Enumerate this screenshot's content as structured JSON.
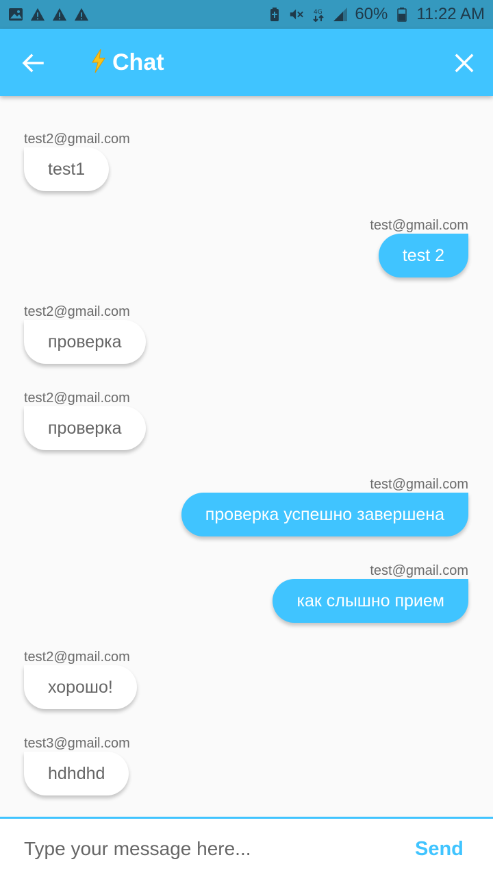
{
  "status_bar": {
    "battery": "60%",
    "time": "11:22 AM",
    "icons_left": [
      "image-icon",
      "warning-icon",
      "warning-icon",
      "warning-icon"
    ],
    "icons_right": [
      "battery-saver-icon",
      "mute-icon",
      "data-icon",
      "signal-icon",
      "battery-icon"
    ]
  },
  "app_bar": {
    "title": "Chat",
    "title_emoji": "⚡",
    "background": "#40c4ff"
  },
  "messages": [
    {
      "sender": "test2@gmail.com",
      "text": "test1",
      "direction": "in"
    },
    {
      "sender": "test@gmail.com",
      "text": "test 2",
      "direction": "out"
    },
    {
      "sender": "test2@gmail.com",
      "text": "проверка",
      "direction": "in"
    },
    {
      "sender": "test2@gmail.com",
      "text": "проверка",
      "direction": "in"
    },
    {
      "sender": "test@gmail.com",
      "text": "проверка успешно завершена",
      "direction": "out"
    },
    {
      "sender": "test@gmail.com",
      "text": "как слышно прием",
      "direction": "out"
    },
    {
      "sender": "test2@gmail.com",
      "text": "хорошо!",
      "direction": "in"
    },
    {
      "sender": "test3@gmail.com",
      "text": "hdhdhd",
      "direction": "in"
    }
  ],
  "composer": {
    "placeholder": "Type your message here...",
    "value": "",
    "send_label": "Send"
  },
  "colors": {
    "accent": "#40c4ff",
    "status_bar": "#3599bf",
    "incoming_bubble": "#ffffff",
    "outgoing_bubble": "#40c4ff"
  }
}
